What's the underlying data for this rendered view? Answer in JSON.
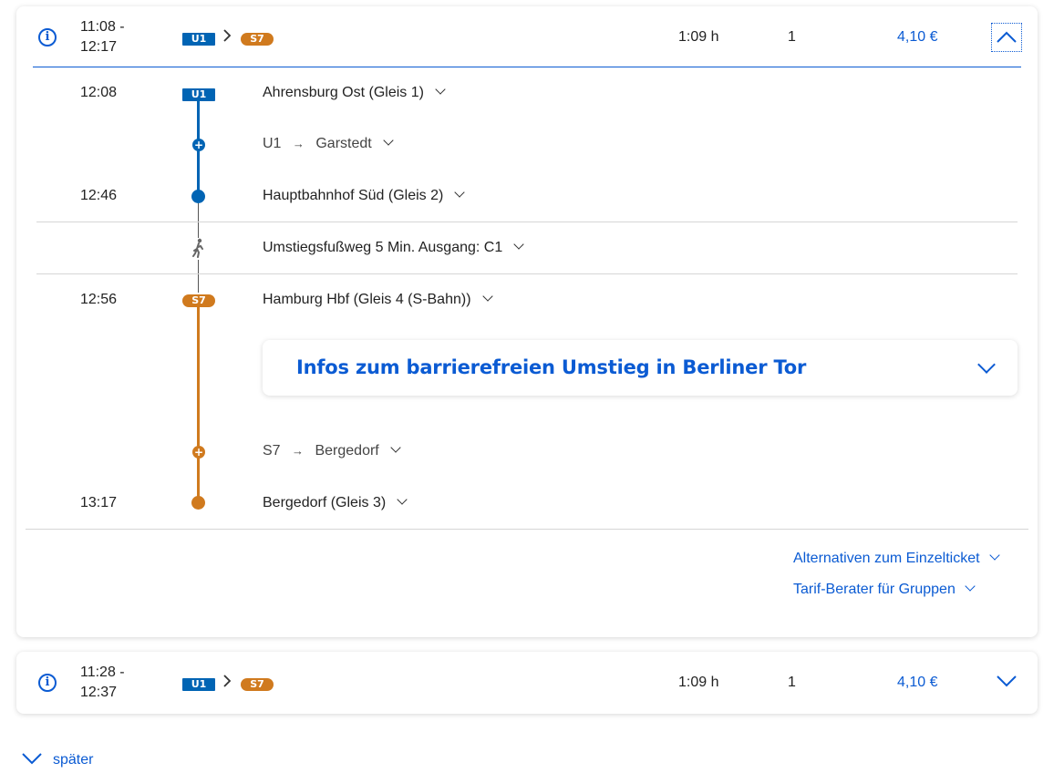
{
  "colors": {
    "accent": "#0b5bd3",
    "u_line": "#0064b4",
    "s_line": "#d07a1e"
  },
  "trips": [
    {
      "time_start": "11:08 -",
      "time_end": "12:17",
      "lines": [
        "U1",
        "S7"
      ],
      "duration": "1:09 h",
      "changes": "1",
      "price": "4,10 €",
      "expanded": true
    },
    {
      "time_start": "11:28 -",
      "time_end": "12:37",
      "lines": [
        "U1",
        "S7"
      ],
      "duration": "1:09 h",
      "changes": "1",
      "price": "4,10 €",
      "expanded": false
    }
  ],
  "detail": {
    "leg1": {
      "badge": "U1",
      "dep_time": "12:08",
      "dep_stop": "Ahrensburg Ost (Gleis 1)",
      "line_label": "U1",
      "arrow": "→",
      "direction": "Garstedt",
      "arr_time": "12:46",
      "arr_stop": "Hauptbahnhof Süd (Gleis 2)"
    },
    "walk": {
      "text": "Umstiegsfußweg 5 Min. Ausgang: C1"
    },
    "leg2": {
      "badge": "S7",
      "dep_time": "12:56",
      "dep_stop": "Hamburg Hbf (Gleis 4 (S-Bahn))",
      "info_panel": "Infos zum barrierefreien Umstieg in Berliner Tor",
      "line_label": "S7",
      "arrow": "→",
      "direction": "Bergedorf",
      "arr_time": "13:17",
      "arr_stop": "Bergedorf (Gleis 3)"
    },
    "links": {
      "alternatives": "Alternativen zum Einzelticket",
      "group_advisor": "Tarif-Berater für Gruppen"
    }
  },
  "footer": {
    "later": "später"
  },
  "icons": {
    "info": "info-icon",
    "chevron_right": "chevron-right-icon",
    "chevron_up": "chevron-up-icon",
    "chevron_down": "chevron-down-icon",
    "walk": "walking-person-icon"
  }
}
